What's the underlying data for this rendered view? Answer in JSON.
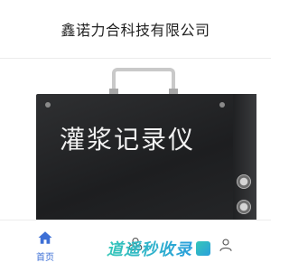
{
  "header": {
    "title": "鑫诺力合科技有限公司"
  },
  "product": {
    "device_label": "灌浆记录仪"
  },
  "nav": {
    "items": [
      {
        "label": "首页",
        "icon": "home-icon",
        "active": true
      },
      {
        "label": "",
        "icon": "products-icon",
        "active": false
      },
      {
        "label": "",
        "icon": "contact-icon",
        "active": false
      }
    ]
  },
  "watermark": {
    "text": "道遥秒收录"
  },
  "colors": {
    "accent": "#3d6fd6",
    "watermark": "#2fb4c8"
  }
}
